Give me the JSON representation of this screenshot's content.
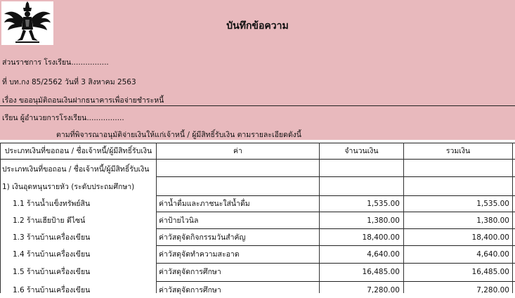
{
  "memo": {
    "title": "บันทึกข้อความ",
    "department": "ส่วนราชการ  โรงเรียน................",
    "ref_line": "ที่ บท.กง 85/2562  วันที่  3  สิงหาคม  2563",
    "subject": "เรื่อง ขออนุมัติถอนเงินฝากธนาคารเพื่อจ่ายชำระหนี้",
    "to": "เรียน   ผู้อำนวยการโรงเรียน................",
    "intro": "ตามที่พิจารณาอนุมัติจ่ายเงินให้แก่เจ้าหนี้ / ผู้มีสิทธิ์รับเงิน ตามรายละเอียดดังนี้"
  },
  "table": {
    "headers": [
      "ประเภทเงินที่ขอถอน / ชื่อเจ้าหนี้/ผู้มีสิทธิ์รับเงิน",
      "ค่า",
      "จำนวนเงิน",
      "รวมเงิน"
    ],
    "section_label": "ประเภทเงินที่ขอถอน / ชื่อเจ้าหนี้/ผู้มีสิทธิ์รับเงิน",
    "group_label": "1) เงินอุดหนุนรายหัว  (ระดับประถมศึกษา)",
    "rows": [
      {
        "name": "1.1  ร้านน้ำแข็งทรัพย์สิน",
        "item": "ค่าน้ำดื่มและภาชนะใส่น้ำดื่ม",
        "amount": "1,535.00",
        "total": "1,535.00"
      },
      {
        "name": "1.2  ร้านเฮียป้าย ดีไซน์",
        "item": "ค่าป้ายไวนิล",
        "amount": "1,380.00",
        "total": "1,380.00"
      },
      {
        "name": "1.3  ร้านบ้านเครื่องเขียน",
        "item": "ค่าวัสดุจัดกิจกรรมวันสำคัญ",
        "amount": "18,400.00",
        "total": "18,400.00"
      },
      {
        "name": "1.4  ร้านบ้านเครื่องเขียน",
        "item": "ค่าวัสดุจัดทำความสะอาด",
        "amount": "4,640.00",
        "total": "4,640.00"
      },
      {
        "name": "1.5  ร้านบ้านเครื่องเขียน",
        "item": "ค่าวัสดุจัดการศึกษา",
        "amount": "16,485.00",
        "total": "16,485.00"
      },
      {
        "name": "1.6  ร้านบ้านเครื่องเขียน",
        "item": "ค่าวัสดุจัดการศึกษา",
        "amount": "7,280.00",
        "total": "7,280.00"
      }
    ]
  },
  "colors": {
    "header_bg": "#e8b9bd",
    "grid": "#333333"
  },
  "icons": {
    "emblem": "garuda-emblem-icon"
  }
}
